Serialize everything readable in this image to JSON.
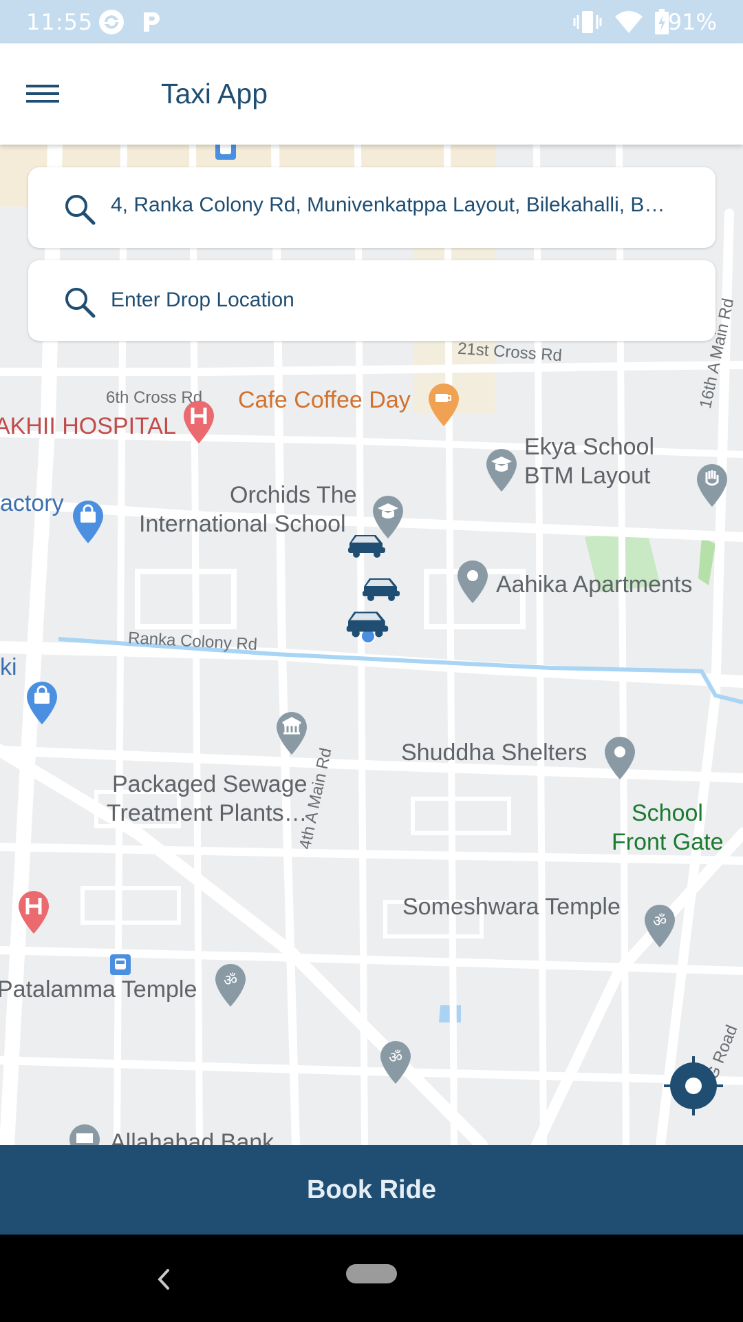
{
  "status_bar": {
    "time": "11:55",
    "battery": "91%",
    "icons": [
      "sync-icon",
      "parking-icon",
      "vibrate-icon",
      "wifi-icon",
      "battery-charging-icon"
    ]
  },
  "app_bar": {
    "title": "Taxi App",
    "menu_icon": "hamburger-menu-icon"
  },
  "pickup": {
    "value": "4, Ranka Colony Rd, Munivenkatppa Layout, Bilekahalli, B…",
    "icon": "search-icon"
  },
  "drop": {
    "placeholder": "Enter Drop Location",
    "icon": "search-icon"
  },
  "map": {
    "roads": {
      "twenty_first_cross": "21st Cross Rd",
      "sixth_cross": "6th Cross Rd",
      "ranka_colony": "Ranka Colony Rd",
      "fourth_a_main": "4th A Main Rd",
      "sixteenth_a_main": "16th A Main Rd",
      "smg_road": "SMG Road"
    },
    "places": {
      "cafe_coffee_day": "Cafe Coffee Day",
      "hospital": "AKHII HOSPITAL",
      "ekya_line1": "Ekya School",
      "ekya_line2": "BTM Layout",
      "factory": "actory",
      "orchids_line1": "Orchids The",
      "orchids_line2": "International School",
      "aahika": "Aahika Apartments",
      "ki": "ki",
      "shuddha": "Shuddha Shelters",
      "sewage_line1": "Packaged Sewage",
      "sewage_line2": "Treatment Plants…",
      "school_gate_line1": "School",
      "school_gate_line2": "Front Gate",
      "someshwara": "Someshwara Temple",
      "patalamma": "Patalamma Temple",
      "allahabad": "Allahabad Bank"
    },
    "colors": {
      "pin_gray": "#8a9aa5",
      "pin_blue": "#4a8fe0",
      "pin_red": "#ea6a70",
      "pin_orange": "#f0a152",
      "car": "#1f4e72",
      "canal": "#a8d4f5"
    }
  },
  "actions": {
    "locate_icon": "my-location-icon",
    "book_ride": "Book Ride"
  },
  "nav_bar": {
    "icons": [
      "back-icon",
      "home-pill-icon"
    ]
  }
}
